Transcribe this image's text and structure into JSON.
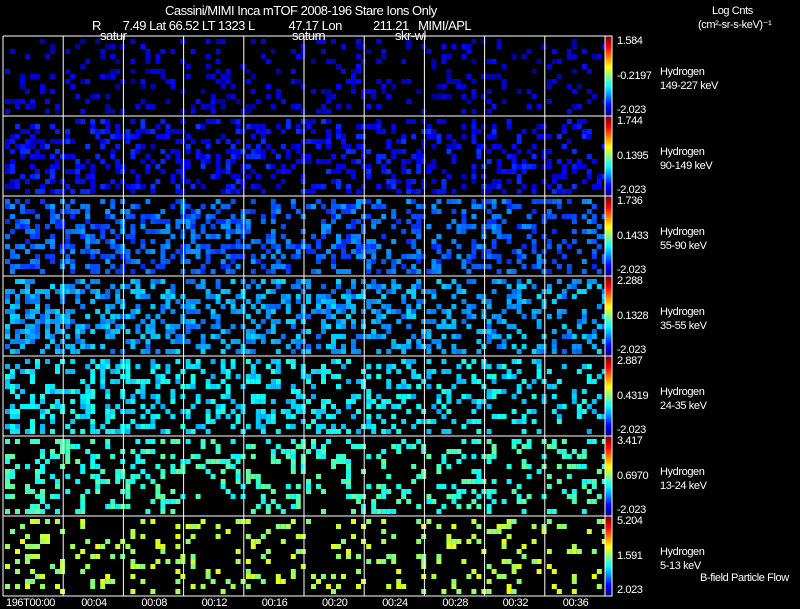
{
  "header": {
    "title": "Cassini/MIMI Inca mTOF  2008-196   Stare   Ions Only",
    "ephemeris": "R       7.49 Lat 66.52 LT 1323 L           47.17 Lon          211.21   MIMI/APL",
    "units_line1": "Log Cnts",
    "units_line2": "(cm²-sr-s-keV)⁻¹",
    "overlay_labels": [
      "satur",
      "saturn",
      "skr-wl"
    ]
  },
  "footer": {
    "legend_note": "B-field Particle Flow"
  },
  "chart_data": {
    "type": "heatmap",
    "colormap": "rainbow (blue to red)",
    "background": "#000000",
    "grid_line_color": "#ffffff",
    "x_tick_labels": [
      "196T00:00",
      "00:04",
      "00:08",
      "00:12",
      "00:16",
      "00:20",
      "00:24",
      "00:28",
      "00:32",
      "00:36"
    ],
    "rows": [
      {
        "species": "Hydrogen",
        "energy": "149-227 keV",
        "cbar_max": "1.584",
        "cbar_mid": "-0.2197",
        "cbar_min": "-2.023"
      },
      {
        "species": "Hydrogen",
        "energy": "90-149 keV",
        "cbar_max": "1.744",
        "cbar_mid": "0.1395",
        "cbar_min": "-2.023"
      },
      {
        "species": "Hydrogen",
        "energy": "55-90 keV",
        "cbar_max": "1.736",
        "cbar_mid": "0.1433",
        "cbar_min": "-2.023"
      },
      {
        "species": "Hydrogen",
        "energy": "35-55 keV",
        "cbar_max": "2.288",
        "cbar_mid": "0.1328",
        "cbar_min": "-2.023"
      },
      {
        "species": "Hydrogen",
        "energy": "24-35 keV",
        "cbar_max": "2.887",
        "cbar_mid": "0.4319",
        "cbar_min": "-2.023"
      },
      {
        "species": "Hydrogen",
        "energy": "13-24 keV",
        "cbar_max": "3.417",
        "cbar_mid": "0.6970",
        "cbar_min": "-2.023"
      },
      {
        "species": "Hydrogen",
        "energy": "5-13 keV",
        "cbar_max": "5.204",
        "cbar_mid": "1.591",
        "cbar_min": "2.023"
      }
    ]
  }
}
